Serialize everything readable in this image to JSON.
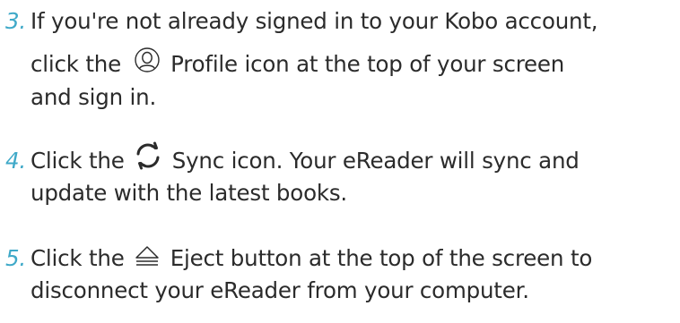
{
  "steps": [
    {
      "number": "3.",
      "line1": "If you're not already signed in to your Kobo account,",
      "line2_before": "click the",
      "icon": "profile-icon",
      "line2_after": "Profile icon at the top of your screen",
      "line3": "and sign in."
    },
    {
      "number": "4.",
      "line1_before": "Click the",
      "icon": "sync-icon",
      "line1_after": "Sync icon. Your eReader will sync and",
      "line2": "update with the latest books."
    },
    {
      "number": "5.",
      "line1_before": "Click the",
      "icon": "eject-icon",
      "line1_after": "Eject button at the top of the screen to",
      "line2": "disconnect your eReader from your computer."
    }
  ],
  "colors": {
    "step_number": "#3fa9c8",
    "text": "#2b2b2b",
    "icon_stroke": "#2b2b2b"
  }
}
